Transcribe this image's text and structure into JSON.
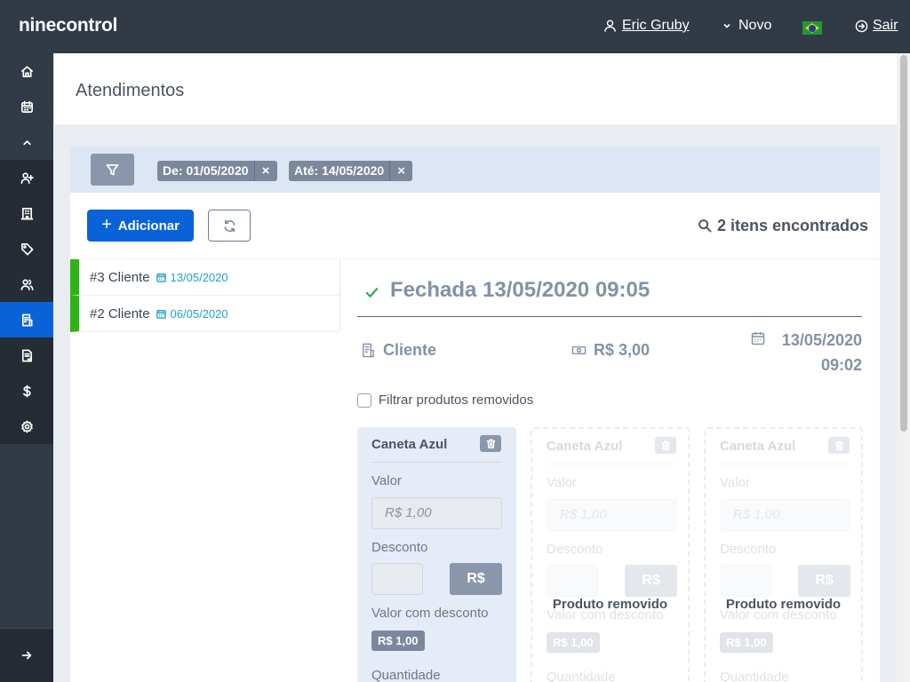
{
  "topbar": {
    "brand": "ninecontrol",
    "user_name": "Eric Gruby",
    "new_label": "Novo",
    "exit_label": "Sair"
  },
  "sidebar": {
    "items": [
      {
        "icon": "home-icon"
      },
      {
        "icon": "calendar-icon"
      },
      {
        "icon": "chevron-up-icon"
      },
      {
        "icon": "user-plus-icon"
      },
      {
        "icon": "building-icon"
      },
      {
        "icon": "tag-icon"
      },
      {
        "icon": "users-icon"
      },
      {
        "icon": "appointments-icon",
        "active": true
      },
      {
        "icon": "document-icon"
      },
      {
        "icon": "dollar-icon"
      },
      {
        "icon": "gear-icon"
      }
    ],
    "footer_icon": "arrow-right-icon"
  },
  "page": {
    "title": "Atendimentos"
  },
  "filters": {
    "tags": [
      "De: 01/05/2020",
      "Até: 14/05/2020"
    ],
    "remove_symbol": "×"
  },
  "toolbar": {
    "add_label": "Adicionar",
    "add_symbol": "+",
    "found_text": "2 itens encontrados"
  },
  "list": [
    {
      "title": "#3 Cliente",
      "date": "13/05/2020"
    },
    {
      "title": "#2 Cliente",
      "date": "06/05/2020"
    }
  ],
  "detail": {
    "status": "Fechada 13/05/2020 09:05",
    "client": "Cliente",
    "total": "R$ 3,00",
    "date_line1": "13/05/2020",
    "date_line2": "09:02",
    "filter_removed_label": "Filtrar produtos removidos",
    "status_color": "#2aa84a"
  },
  "products": [
    {
      "name": "Caneta Azul",
      "value_label": "Valor",
      "value": "R$ 1,00",
      "discount_label": "Desconto",
      "currency": "R$",
      "discounted_label": "Valor com desconto",
      "discounted_value": "R$ 1,00",
      "quantity_label": "Quantidade",
      "removed": false
    },
    {
      "name": "Caneta Azul",
      "value_label": "Valor",
      "value": "R$ 1,00",
      "discount_label": "Desconto",
      "currency": "R$",
      "discounted_label": "Valor com desconto",
      "discounted_value": "R$ 1,00",
      "quantity_label": "Quantidade",
      "removed": true,
      "removed_text": "Produto removido"
    },
    {
      "name": "Caneta Azul",
      "value_label": "Valor",
      "value": "R$ 1,00",
      "discount_label": "Desconto",
      "currency": "R$",
      "discounted_label": "Valor com desconto",
      "discounted_value": "R$ 1,00",
      "quantity_label": "Quantidade",
      "removed": true,
      "removed_text": "Produto removido"
    }
  ],
  "colors": {
    "primary": "#0a62d8",
    "sidebar": "#323a46",
    "list_accent": "#2db516",
    "date_accent": "#22a0c8"
  }
}
